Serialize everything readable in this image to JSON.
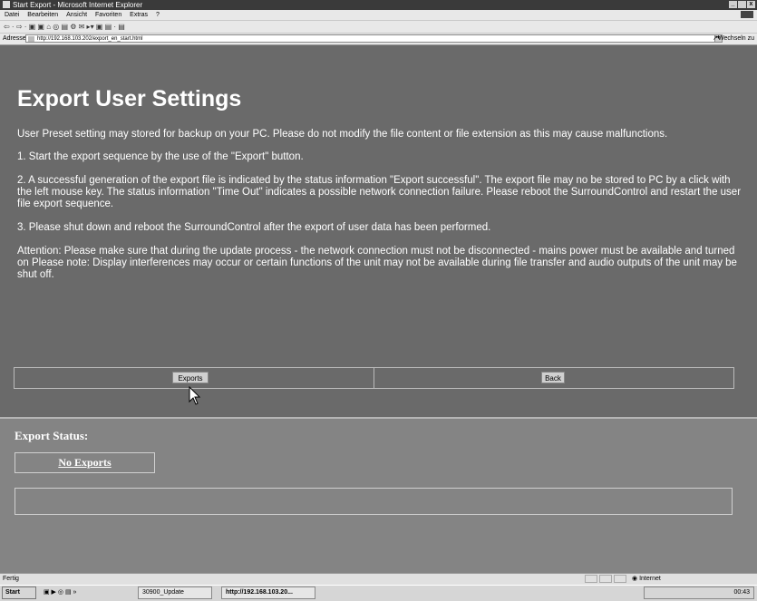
{
  "window": {
    "title": "Start Export - Microsoft Internet Explorer",
    "controls": [
      "_",
      " ",
      "x"
    ]
  },
  "menu": [
    "Datei",
    "Bearbeiten",
    "Ansicht",
    "Favoriten",
    "Extras",
    "?"
  ],
  "toolbar": {
    "glyphs": "⇦ · ⇨ · ▣ ▣ ⌂ ◎ ▤ ⚙ ✉ ▸▾ ▣ ▤ · ▤"
  },
  "address": {
    "label": "Adresse",
    "url": "http://192.168.103.202/export_en_start.html",
    "go_label": "Wechseln zu"
  },
  "page": {
    "title": "Export User Settings",
    "paragraphs": [
      "User Preset setting may stored for backup on your PC. Please do not modify the file content or file extension as this may cause malfunctions.",
      "1. Start the export sequence by the use of the \"Export\" button.",
      "2. A successful generation of the export file is indicated by the status information \"Export successful\". The export file may no be stored to PC by a click with the left mouse key. The status information \"Time Out\" indicates a possible network connection failure. Please reboot the SurroundControl and restart the user file export sequence.",
      "3. Please shut down and reboot the SurroundControl after the export of user data has been performed.",
      "Attention: Please make sure that during the update process - the network connection must not be disconnected - mains power must be available and turned on Please note: Display interferences may occur or certain functions of the unit may not be available during file transfer and audio outputs of the unit may be shut off."
    ],
    "exports_button": "Exports",
    "back_button": "Back"
  },
  "status": {
    "heading": "Export Status:",
    "value": "No Exports"
  },
  "ie_status": {
    "left": "Fertig",
    "zone": "Internet"
  },
  "taskbar": {
    "start": "Start",
    "quicklaunch": "▣ ▶ ◎ ▤",
    "overflow": "»",
    "tasks": [
      "30900_Update",
      "http://192.168.103.20..."
    ],
    "clock": "00:43"
  }
}
